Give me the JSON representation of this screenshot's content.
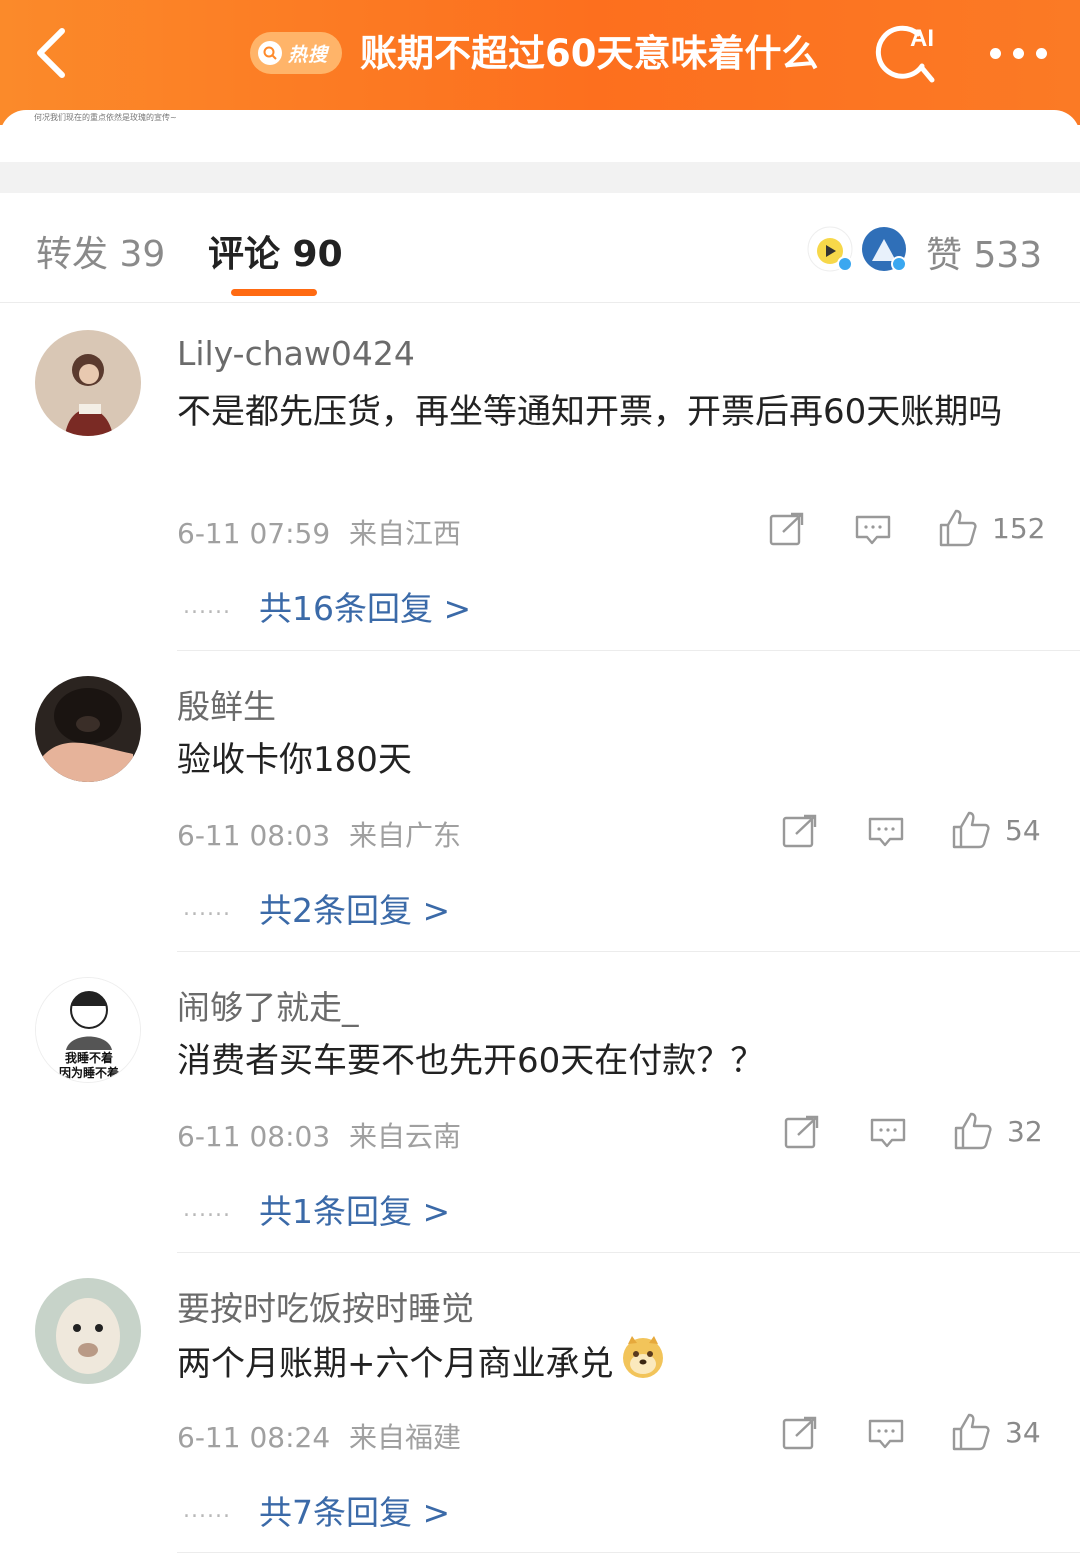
{
  "header": {
    "back_icon": "chevron-left-icon",
    "hot_search_label": "热搜",
    "title": "账期不超过60天意味着什么",
    "ai_label": "AI",
    "more_icon": "more-dots-icon",
    "accent_color": "#fd6f1e"
  },
  "post_snippet": "何况我们现在的重点依然是玫瑰的宣传~",
  "tabs": {
    "repost": "转发 39",
    "comment": "评论 90",
    "likes": "赞 533"
  },
  "comments": [
    {
      "username": "Lily-chaw0424",
      "text": "不是都先压货，再坐等通知开票，开票后再60天账期吗",
      "time": "6-11 07:59",
      "location": "来自江西",
      "likes": "152",
      "dots": "......",
      "replies": "共16条回复 >"
    },
    {
      "username": "殷鲜生",
      "text": "验收卡你180天",
      "time": "6-11 08:03",
      "location": "来自广东",
      "likes": "54",
      "dots": "......",
      "replies": "共2条回复 >"
    },
    {
      "username": "闹够了就走_",
      "text": "消费者买车要不也先开60天在付款？？",
      "time": "6-11 08:03",
      "location": "来自云南",
      "likes": "32",
      "dots": "......",
      "replies": "共1条回复 >",
      "avatar_text": [
        "我睡不着",
        "因为睡不着"
      ]
    },
    {
      "username": "要按时吃饭按时睡觉",
      "text": "两个月账期+六个月商业承兑",
      "time": "6-11 08:24",
      "location": "来自福建",
      "likes": "34",
      "dots": "......",
      "replies": "共7条回复 >"
    }
  ]
}
